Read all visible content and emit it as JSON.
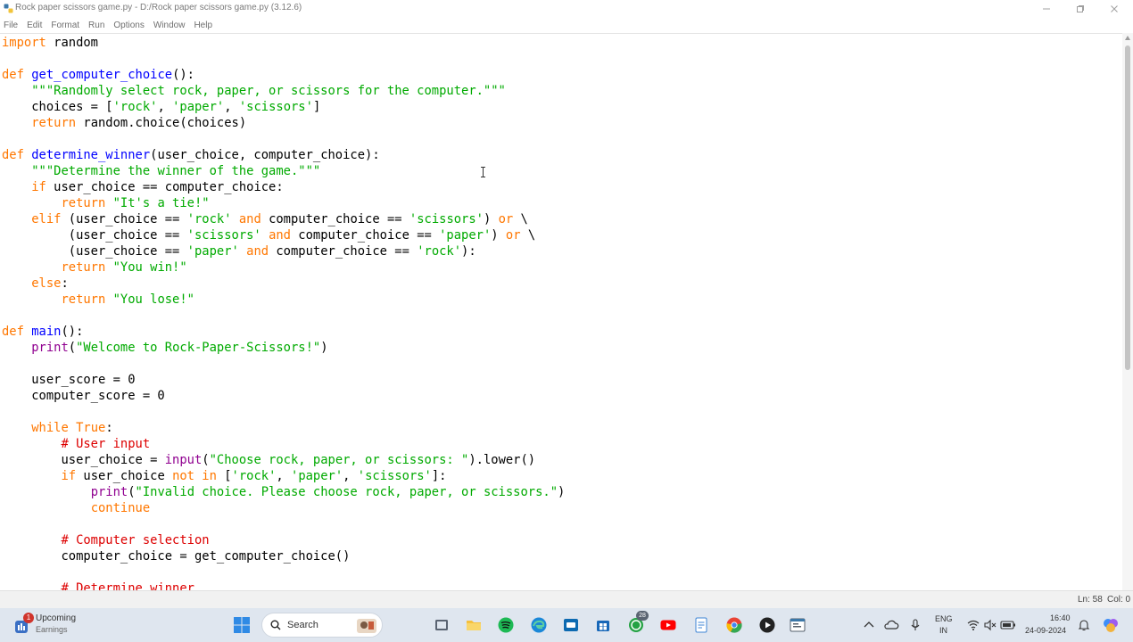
{
  "window": {
    "title": "Rock paper scissors game.py - D:/Rock paper scissors game.py (3.12.6)",
    "controls": [
      "minimize",
      "restore",
      "close"
    ]
  },
  "menu": [
    "File",
    "Edit",
    "Format",
    "Run",
    "Options",
    "Window",
    "Help"
  ],
  "code_lines": [
    [
      [
        "kw",
        "import"
      ],
      [
        "t",
        " random"
      ]
    ],
    [],
    [
      [
        "kw",
        "def"
      ],
      [
        "t",
        " "
      ],
      [
        "fn",
        "get_computer_choice"
      ],
      [
        "t",
        "():"
      ]
    ],
    [
      [
        "t",
        "    "
      ],
      [
        "str",
        "\"\"\"Randomly select rock, paper, or scissors for the computer.\"\"\""
      ]
    ],
    [
      [
        "t",
        "    choices = ["
      ],
      [
        "str",
        "'rock'"
      ],
      [
        "t",
        ", "
      ],
      [
        "str",
        "'paper'"
      ],
      [
        "t",
        ", "
      ],
      [
        "str",
        "'scissors'"
      ],
      [
        "t",
        "]"
      ]
    ],
    [
      [
        "t",
        "    "
      ],
      [
        "kw",
        "return"
      ],
      [
        "t",
        " random.choice(choices)"
      ]
    ],
    [],
    [
      [
        "kw",
        "def"
      ],
      [
        "t",
        " "
      ],
      [
        "fn",
        "determine_winner"
      ],
      [
        "t",
        "(user_choice, computer_choice):"
      ]
    ],
    [
      [
        "t",
        "    "
      ],
      [
        "str",
        "\"\"\"Determine the winner of the game.\"\"\""
      ]
    ],
    [
      [
        "t",
        "    "
      ],
      [
        "kw",
        "if"
      ],
      [
        "t",
        " user_choice == computer_choice:"
      ]
    ],
    [
      [
        "t",
        "        "
      ],
      [
        "kw",
        "return"
      ],
      [
        "t",
        " "
      ],
      [
        "str",
        "\"It's a tie!\""
      ]
    ],
    [
      [
        "t",
        "    "
      ],
      [
        "kw",
        "elif"
      ],
      [
        "t",
        " (user_choice == "
      ],
      [
        "str",
        "'rock'"
      ],
      [
        "t",
        " "
      ],
      [
        "kw",
        "and"
      ],
      [
        "t",
        " computer_choice == "
      ],
      [
        "str",
        "'scissors'"
      ],
      [
        "t",
        ") "
      ],
      [
        "kw",
        "or"
      ],
      [
        "t",
        " \\"
      ]
    ],
    [
      [
        "t",
        "         (user_choice == "
      ],
      [
        "str",
        "'scissors'"
      ],
      [
        "t",
        " "
      ],
      [
        "kw",
        "and"
      ],
      [
        "t",
        " computer_choice == "
      ],
      [
        "str",
        "'paper'"
      ],
      [
        "t",
        ") "
      ],
      [
        "kw",
        "or"
      ],
      [
        "t",
        " \\"
      ]
    ],
    [
      [
        "t",
        "         (user_choice == "
      ],
      [
        "str",
        "'paper'"
      ],
      [
        "t",
        " "
      ],
      [
        "kw",
        "and"
      ],
      [
        "t",
        " computer_choice == "
      ],
      [
        "str",
        "'rock'"
      ],
      [
        "t",
        "):"
      ]
    ],
    [
      [
        "t",
        "        "
      ],
      [
        "kw",
        "return"
      ],
      [
        "t",
        " "
      ],
      [
        "str",
        "\"You win!\""
      ]
    ],
    [
      [
        "t",
        "    "
      ],
      [
        "kw",
        "else"
      ],
      [
        "t",
        ":"
      ]
    ],
    [
      [
        "t",
        "        "
      ],
      [
        "kw",
        "return"
      ],
      [
        "t",
        " "
      ],
      [
        "str",
        "\"You lose!\""
      ]
    ],
    [],
    [
      [
        "kw",
        "def"
      ],
      [
        "t",
        " "
      ],
      [
        "fn",
        "main"
      ],
      [
        "t",
        "():"
      ]
    ],
    [
      [
        "t",
        "    "
      ],
      [
        "bi",
        "print"
      ],
      [
        "t",
        "("
      ],
      [
        "str",
        "\"Welcome to Rock-Paper-Scissors!\""
      ],
      [
        "t",
        ")"
      ]
    ],
    [],
    [
      [
        "t",
        "    user_score = 0"
      ]
    ],
    [
      [
        "t",
        "    computer_score = 0"
      ]
    ],
    [],
    [
      [
        "t",
        "    "
      ],
      [
        "kw",
        "while"
      ],
      [
        "t",
        " "
      ],
      [
        "kw",
        "True"
      ],
      [
        "t",
        ":"
      ]
    ],
    [
      [
        "t",
        "        "
      ],
      [
        "cm",
        "# User input"
      ]
    ],
    [
      [
        "t",
        "        user_choice = "
      ],
      [
        "bi",
        "input"
      ],
      [
        "t",
        "("
      ],
      [
        "str",
        "\"Choose rock, paper, or scissors: \""
      ],
      [
        "t",
        ").lower()"
      ]
    ],
    [
      [
        "t",
        "        "
      ],
      [
        "kw",
        "if"
      ],
      [
        "t",
        " user_choice "
      ],
      [
        "kw",
        "not"
      ],
      [
        "t",
        " "
      ],
      [
        "kw",
        "in"
      ],
      [
        "t",
        " ["
      ],
      [
        "str",
        "'rock'"
      ],
      [
        "t",
        ", "
      ],
      [
        "str",
        "'paper'"
      ],
      [
        "t",
        ", "
      ],
      [
        "str",
        "'scissors'"
      ],
      [
        "t",
        "]:"
      ]
    ],
    [
      [
        "t",
        "            "
      ],
      [
        "bi",
        "print"
      ],
      [
        "t",
        "("
      ],
      [
        "str",
        "\"Invalid choice. Please choose rock, paper, or scissors.\""
      ],
      [
        "t",
        ")"
      ]
    ],
    [
      [
        "t",
        "            "
      ],
      [
        "kw",
        "continue"
      ]
    ],
    [],
    [
      [
        "t",
        "        "
      ],
      [
        "cm",
        "# Computer selection"
      ]
    ],
    [
      [
        "t",
        "        computer_choice = get_computer_choice()"
      ]
    ],
    [],
    [
      [
        "t",
        "        "
      ],
      [
        "cm",
        "# Determine winner"
      ]
    ]
  ],
  "colors": {
    "keyword": "#ff7700",
    "string": "#00aa00",
    "definition": "#0000ff",
    "builtin": "#900090",
    "comment": "#dd0000"
  },
  "status": {
    "line": "Ln: 58",
    "col": "Col: 0"
  },
  "taskbar": {
    "weather_title": "Upcoming",
    "weather_subtitle": "Earnings",
    "weather_badge": "1",
    "search_label": "Search",
    "notification_badge": "28",
    "language_top": "ENG",
    "language_bottom": "IN",
    "time": "16:40",
    "date": "24-09-2024"
  }
}
